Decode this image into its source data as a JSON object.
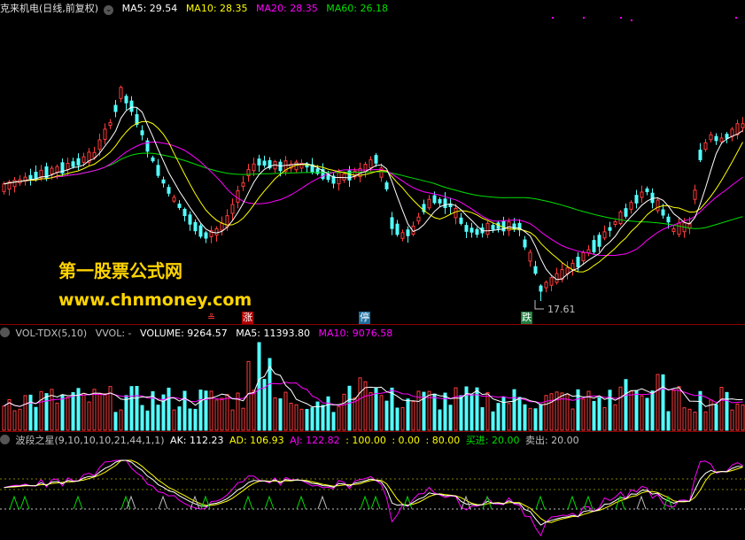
{
  "header_main": {
    "title": "克来机电(日线,前复权)",
    "dropdown_icon": "⌄",
    "ma5": "MA5: 29.54",
    "ma10": "MA10: 28.35",
    "ma20": "MA20: 28.35",
    "ma60": "MA60: 26.18"
  },
  "header_vol": {
    "title": "VOL-TDX(5,10)",
    "vvol": "VVOL: -",
    "volume": "VOLUME: 9264.57",
    "ma5": "MA5: 11393.80",
    "ma10": "MA10: 9076.58"
  },
  "header_ind": {
    "title": "波段之星(9,10,10,10,21,44,1,1)",
    "ak": "AK: 112.23",
    "ad": "AD: 106.93",
    "aj": "AJ: 122.82",
    "v100": ": 100.00",
    "v0": ": 0.00",
    "v80": ": 80.00",
    "buy": "买进: 20.00",
    "sell": "卖出: 20.00"
  },
  "watermark": {
    "line1": "第一股票公式网",
    "line2": "www.chnmoney.com"
  },
  "badges": {
    "b1": "≗",
    "b2": "涨",
    "b3": "停",
    "b4": "跌"
  },
  "low_label": "17.61",
  "colors": {
    "up": "#ff3c3c",
    "down": "#54ffff",
    "ma5": "#ffffff",
    "ma10": "#ffff00",
    "ma20": "#ff00ff",
    "ma60": "#00e000",
    "divider": "#8b0000"
  },
  "chart_data": [
    {
      "type": "candlestick",
      "title": "克来机电(日线,前复权)",
      "series": [
        {
          "name": "MA5",
          "last": 29.54
        },
        {
          "name": "MA10",
          "last": 28.35
        },
        {
          "name": "MA20",
          "last": 28.35
        },
        {
          "name": "MA60",
          "last": 26.18
        }
      ],
      "annotations": [
        {
          "label": "17.61",
          "meaning": "period low"
        }
      ],
      "ylim": [
        15,
        40
      ]
    },
    {
      "type": "bar",
      "title": "VOL-TDX(5,10)",
      "series": [
        {
          "name": "VOLUME",
          "last": 9264.57
        },
        {
          "name": "MA5",
          "last": 11393.8
        },
        {
          "name": "MA10",
          "last": 9076.58
        }
      ]
    },
    {
      "type": "line",
      "title": "波段之星(9,10,10,10,21,44,1,1)",
      "series": [
        {
          "name": "AK",
          "last": 112.23
        },
        {
          "name": "AD",
          "last": 106.93
        },
        {
          "name": "AJ",
          "last": 122.82
        }
      ],
      "reference_lines": [
        100,
        0,
        80,
        20
      ],
      "signals": {
        "买进": 20.0,
        "卖出": 20.0
      }
    }
  ]
}
